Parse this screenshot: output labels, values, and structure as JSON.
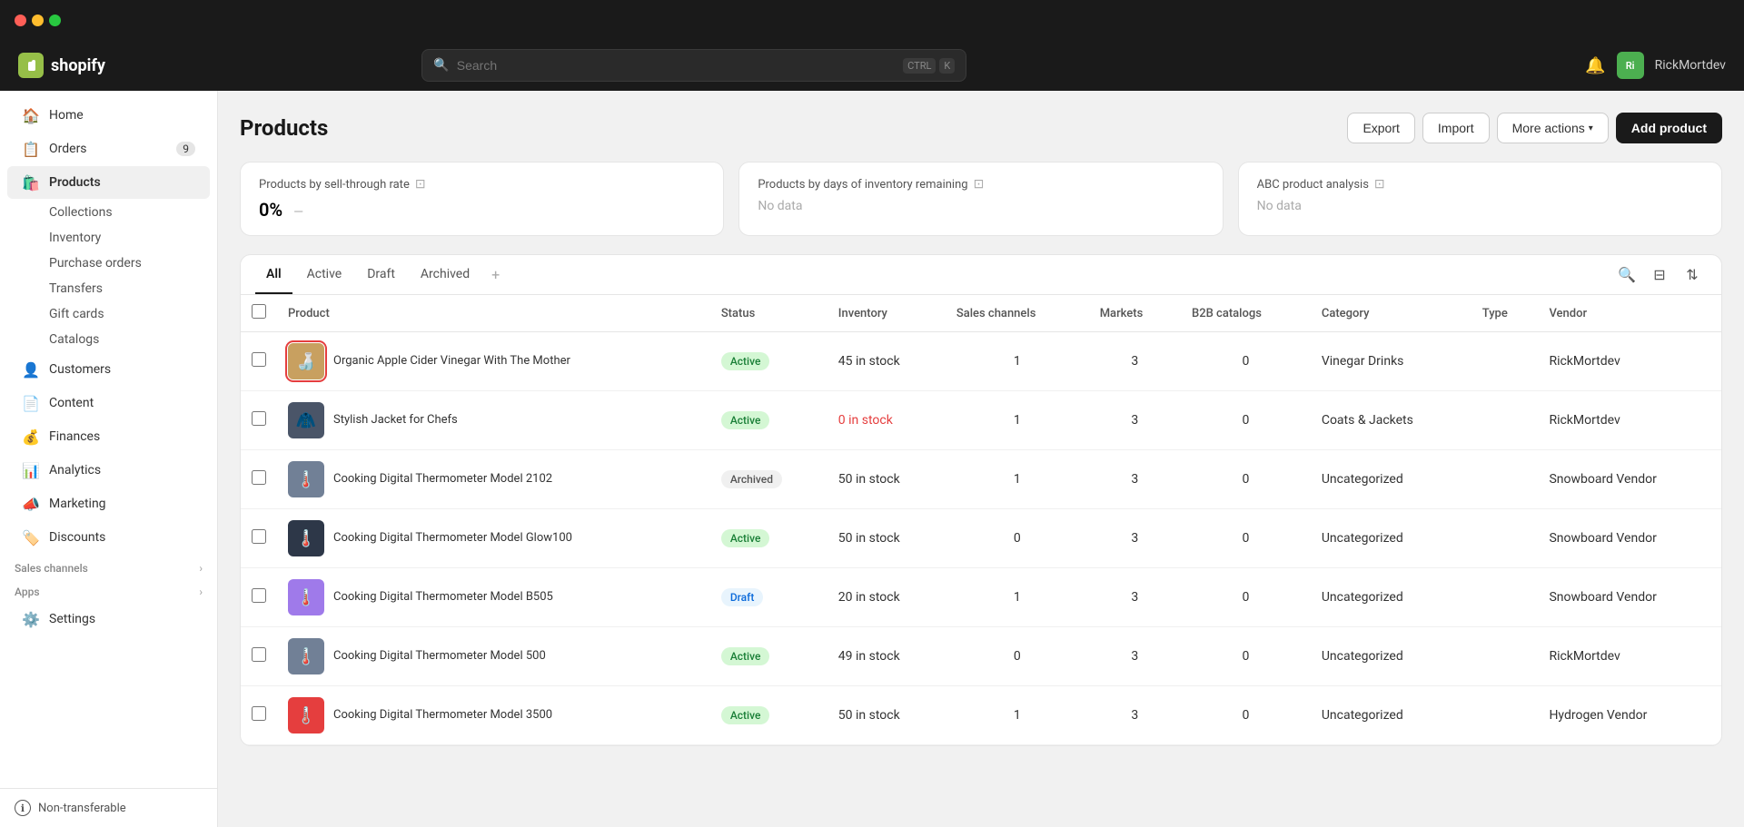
{
  "titlebar": {
    "traffic_lights": [
      "red",
      "yellow",
      "green"
    ]
  },
  "header": {
    "logo_text": "shopify",
    "search_placeholder": "Search",
    "search_shortcut": [
      "CTRL",
      "K"
    ],
    "notification_icon": "🔔",
    "avatar_text": "Ri",
    "username": "RickMortdev"
  },
  "sidebar": {
    "items": [
      {
        "id": "home",
        "label": "Home",
        "icon": "🏠",
        "active": false,
        "badge": null
      },
      {
        "id": "orders",
        "label": "Orders",
        "icon": "📋",
        "active": false,
        "badge": "9"
      },
      {
        "id": "products",
        "label": "Products",
        "icon": "🛍️",
        "active": true,
        "badge": null
      }
    ],
    "sub_items": [
      {
        "id": "collections",
        "label": "Collections",
        "active": false
      },
      {
        "id": "inventory",
        "label": "Inventory",
        "active": false
      },
      {
        "id": "purchase_orders",
        "label": "Purchase orders",
        "active": false
      },
      {
        "id": "transfers",
        "label": "Transfers",
        "active": false
      },
      {
        "id": "gift_cards",
        "label": "Gift cards",
        "active": false
      },
      {
        "id": "catalogs",
        "label": "Catalogs",
        "active": false
      }
    ],
    "other_items": [
      {
        "id": "customers",
        "label": "Customers",
        "icon": "👤",
        "active": false
      },
      {
        "id": "content",
        "label": "Content",
        "icon": "📄",
        "active": false
      },
      {
        "id": "finances",
        "label": "Finances",
        "icon": "💰",
        "active": false
      },
      {
        "id": "analytics",
        "label": "Analytics",
        "icon": "📊",
        "active": false
      },
      {
        "id": "marketing",
        "label": "Marketing",
        "icon": "📣",
        "active": false
      },
      {
        "id": "discounts",
        "label": "Discounts",
        "icon": "🏷️",
        "active": false
      }
    ],
    "sections": [
      {
        "id": "sales_channels",
        "label": "Sales channels",
        "expanded": true
      },
      {
        "id": "apps",
        "label": "Apps",
        "expanded": true
      }
    ],
    "footer": {
      "icon": "ℹ",
      "label": "Non-transferable"
    },
    "settings": {
      "icon": "⚙️",
      "label": "Settings"
    }
  },
  "page": {
    "title": "Products",
    "actions": {
      "export_label": "Export",
      "import_label": "Import",
      "more_actions_label": "More actions",
      "add_product_label": "Add product"
    }
  },
  "stats": [
    {
      "id": "sell_through",
      "label": "Products by sell-through rate",
      "value": "0%",
      "sub": "—",
      "no_data": null
    },
    {
      "id": "days_inventory",
      "label": "Products by days of inventory remaining",
      "value": null,
      "no_data": "No data"
    },
    {
      "id": "abc_analysis",
      "label": "ABC product analysis",
      "value": null,
      "no_data": "No data"
    }
  ],
  "table": {
    "tabs": [
      "All",
      "Active",
      "Draft",
      "Archived"
    ],
    "active_tab": "All",
    "columns": [
      "Product",
      "Status",
      "Inventory",
      "Sales channels",
      "Markets",
      "B2B catalogs",
      "Category",
      "Type",
      "Vendor"
    ],
    "rows": [
      {
        "id": 1,
        "thumb_emoji": "🍎",
        "thumb_color": "#c8a060",
        "name": "Organic Apple Cider Vinegar With The Mother",
        "highlighted": true,
        "status": "Active",
        "status_type": "active",
        "inventory": "45 in stock",
        "inventory_warning": false,
        "sales_channels": "1",
        "markets": "3",
        "b2b": "0",
        "category": "Vinegar Drinks",
        "type": "",
        "vendor": "RickMortdev"
      },
      {
        "id": 2,
        "thumb_emoji": "🧥",
        "thumb_color": "#4a5568",
        "name": "Stylish Jacket for Chefs",
        "highlighted": false,
        "status": "Active",
        "status_type": "active",
        "inventory": "0 in stock",
        "inventory_warning": true,
        "sales_channels": "1",
        "markets": "3",
        "b2b": "0",
        "category": "Coats & Jackets",
        "type": "",
        "vendor": "RickMortdev"
      },
      {
        "id": 3,
        "thumb_emoji": "🌡️",
        "thumb_color": "#718096",
        "name": "Cooking Digital Thermometer Model 2102",
        "highlighted": false,
        "status": "Archived",
        "status_type": "archived",
        "inventory": "50 in stock",
        "inventory_warning": false,
        "sales_channels": "1",
        "markets": "3",
        "b2b": "0",
        "category": "Uncategorized",
        "type": "",
        "vendor": "Snowboard Vendor"
      },
      {
        "id": 4,
        "thumb_emoji": "🌡️",
        "thumb_color": "#2d3748",
        "name": "Cooking Digital Thermometer Model Glow100",
        "highlighted": false,
        "status": "Active",
        "status_type": "active",
        "inventory": "50 in stock",
        "inventory_warning": false,
        "sales_channels": "0",
        "markets": "3",
        "b2b": "0",
        "category": "Uncategorized",
        "type": "",
        "vendor": "Snowboard Vendor"
      },
      {
        "id": 5,
        "thumb_emoji": "🌡️",
        "thumb_color": "#9f7aea",
        "name": "Cooking Digital Thermometer Model B505",
        "highlighted": false,
        "status": "Draft",
        "status_type": "draft",
        "inventory": "20 in stock",
        "inventory_warning": false,
        "sales_channels": "1",
        "markets": "3",
        "b2b": "0",
        "category": "Uncategorized",
        "type": "",
        "vendor": "Snowboard Vendor"
      },
      {
        "id": 6,
        "thumb_emoji": "🌡️",
        "thumb_color": "#718096",
        "name": "Cooking Digital Thermometer Model 500",
        "highlighted": false,
        "status": "Active",
        "status_type": "active",
        "inventory": "49 in stock",
        "inventory_warning": false,
        "sales_channels": "0",
        "markets": "3",
        "b2b": "0",
        "category": "Uncategorized",
        "type": "",
        "vendor": "RickMortdev"
      },
      {
        "id": 7,
        "thumb_emoji": "🌡️",
        "thumb_color": "#e53e3e",
        "name": "Cooking Digital Thermometer Model 3500",
        "highlighted": false,
        "status": "Active",
        "status_type": "active",
        "inventory": "50 in stock",
        "inventory_warning": false,
        "sales_channels": "1",
        "markets": "3",
        "b2b": "0",
        "category": "Uncategorized",
        "type": "",
        "vendor": "Hydrogen Vendor"
      }
    ]
  },
  "icons": {
    "search": "🔍",
    "filter": "⊟",
    "sort": "⇅"
  }
}
